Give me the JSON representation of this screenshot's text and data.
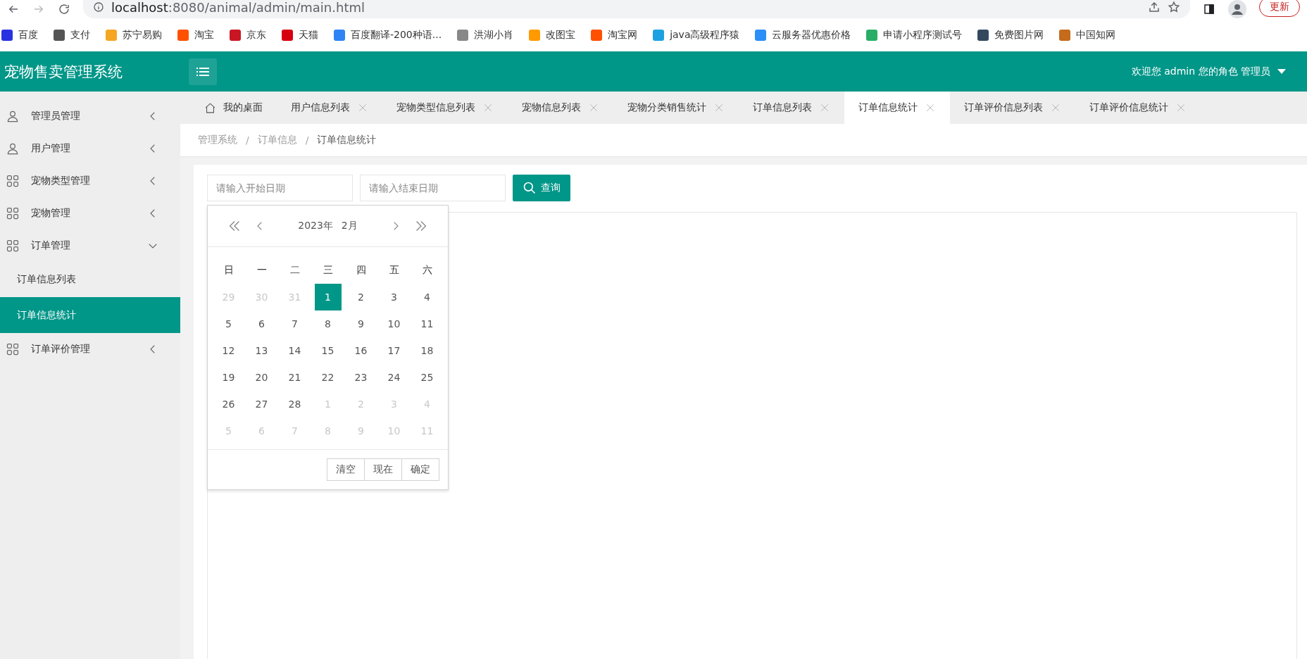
{
  "browser": {
    "url_host": "localhost",
    "url_rest": ":8080/animal/admin/main.html",
    "update_button": "更新",
    "bookmarks": [
      {
        "label": "百度",
        "color": "#2932e1"
      },
      {
        "label": "支付",
        "color": "#555555"
      },
      {
        "label": "苏宁易购",
        "color": "#f5a623"
      },
      {
        "label": "淘宝",
        "color": "#ff5000"
      },
      {
        "label": "京东",
        "color": "#c91623"
      },
      {
        "label": "天猫",
        "color": "#d6000f"
      },
      {
        "label": "百度翻译-200种语...",
        "color": "#2e84f4"
      },
      {
        "label": "洪湖小肖",
        "color": "#888888"
      },
      {
        "label": "改图宝",
        "color": "#ff9a00"
      },
      {
        "label": "淘宝网",
        "color": "#ff5000"
      },
      {
        "label": "java高级程序猿",
        "color": "#1ba1e2"
      },
      {
        "label": "云服务器优惠价格",
        "color": "#2c8ef8"
      },
      {
        "label": "申请小程序测试号",
        "color": "#2aae67"
      },
      {
        "label": "免费图片网",
        "color": "#34495e"
      },
      {
        "label": "中国知网",
        "color": "#c46b1c"
      }
    ]
  },
  "header": {
    "title": "宠物售卖管理系统",
    "user": "欢迎您 admin 您的角色 管理员"
  },
  "sidebar": {
    "items": [
      {
        "label": "管理员管理",
        "kind": "user",
        "expanded": false
      },
      {
        "label": "用户管理",
        "kind": "user",
        "expanded": false
      },
      {
        "label": "宠物类型管理",
        "kind": "grid",
        "expanded": false
      },
      {
        "label": "宠物管理",
        "kind": "grid",
        "expanded": false
      },
      {
        "label": "订单管理",
        "kind": "grid",
        "expanded": true,
        "children": [
          {
            "label": "订单信息列表",
            "selected": false
          },
          {
            "label": "订单信息统计",
            "selected": true
          }
        ]
      },
      {
        "label": "订单评价管理",
        "kind": "grid",
        "expanded": false
      }
    ]
  },
  "tabs": [
    {
      "label": "我的桌面",
      "kind": "home",
      "selected": false
    },
    {
      "label": "用户信息列表",
      "kind": "page",
      "selected": false
    },
    {
      "label": "宠物类型信息列表",
      "kind": "page",
      "selected": false
    },
    {
      "label": "宠物信息列表",
      "kind": "page",
      "selected": false
    },
    {
      "label": "宠物分类销售统计",
      "kind": "page",
      "selected": false
    },
    {
      "label": "订单信息列表",
      "kind": "page",
      "selected": false
    },
    {
      "label": "订单信息统计",
      "kind": "page",
      "selected": true
    },
    {
      "label": "订单评价信息列表",
      "kind": "page",
      "selected": false
    },
    {
      "label": "订单评价信息统计",
      "kind": "page",
      "selected": false
    }
  ],
  "breadcrumb": [
    {
      "kind": "link",
      "label": "管理系统"
    },
    {
      "kind": "separator",
      "label": "/"
    },
    {
      "kind": "link",
      "label": "订单信息"
    },
    {
      "kind": "separator",
      "label": "/"
    },
    {
      "kind": "current",
      "label": "订单信息统计"
    }
  ],
  "search": {
    "start_placeholder": "请输入开始日期",
    "end_placeholder": "请输入结束日期",
    "button": "查询"
  },
  "calendar": {
    "year": "2023年",
    "month": "2月",
    "weekdays": [
      "日",
      "一",
      "二",
      "三",
      "四",
      "五",
      "六"
    ],
    "weeks": [
      [
        {
          "label": "29",
          "outside": true,
          "selected": false
        },
        {
          "label": "30",
          "outside": true,
          "selected": false
        },
        {
          "label": "31",
          "outside": true,
          "selected": false
        },
        {
          "label": "1",
          "outside": false,
          "selected": true
        },
        {
          "label": "2",
          "outside": false,
          "selected": false
        },
        {
          "label": "3",
          "outside": false,
          "selected": false
        },
        {
          "label": "4",
          "outside": false,
          "selected": false
        }
      ],
      [
        {
          "label": "5",
          "outside": false,
          "selected": false
        },
        {
          "label": "6",
          "outside": false,
          "selected": false
        },
        {
          "label": "7",
          "outside": false,
          "selected": false
        },
        {
          "label": "8",
          "outside": false,
          "selected": false
        },
        {
          "label": "9",
          "outside": false,
          "selected": false
        },
        {
          "label": "10",
          "outside": false,
          "selected": false
        },
        {
          "label": "11",
          "outside": false,
          "selected": false
        }
      ],
      [
        {
          "label": "12",
          "outside": false,
          "selected": false
        },
        {
          "label": "13",
          "outside": false,
          "selected": false
        },
        {
          "label": "14",
          "outside": false,
          "selected": false
        },
        {
          "label": "15",
          "outside": false,
          "selected": false
        },
        {
          "label": "16",
          "outside": false,
          "selected": false
        },
        {
          "label": "17",
          "outside": false,
          "selected": false
        },
        {
          "label": "18",
          "outside": false,
          "selected": false
        }
      ],
      [
        {
          "label": "19",
          "outside": false,
          "selected": false
        },
        {
          "label": "20",
          "outside": false,
          "selected": false
        },
        {
          "label": "21",
          "outside": false,
          "selected": false
        },
        {
          "label": "22",
          "outside": false,
          "selected": false
        },
        {
          "label": "23",
          "outside": false,
          "selected": false
        },
        {
          "label": "24",
          "outside": false,
          "selected": false
        },
        {
          "label": "25",
          "outside": false,
          "selected": false
        }
      ],
      [
        {
          "label": "26",
          "outside": false,
          "selected": false
        },
        {
          "label": "27",
          "outside": false,
          "selected": false
        },
        {
          "label": "28",
          "outside": false,
          "selected": false
        },
        {
          "label": "1",
          "outside": true,
          "selected": false
        },
        {
          "label": "2",
          "outside": true,
          "selected": false
        },
        {
          "label": "3",
          "outside": true,
          "selected": false
        },
        {
          "label": "4",
          "outside": true,
          "selected": false
        }
      ],
      [
        {
          "label": "5",
          "outside": true,
          "selected": false
        },
        {
          "label": "6",
          "outside": true,
          "selected": false
        },
        {
          "label": "7",
          "outside": true,
          "selected": false
        },
        {
          "label": "8",
          "outside": true,
          "selected": false
        },
        {
          "label": "9",
          "outside": true,
          "selected": false
        },
        {
          "label": "10",
          "outside": true,
          "selected": false
        },
        {
          "label": "11",
          "outside": true,
          "selected": false
        }
      ]
    ],
    "buttons": [
      "清空",
      "现在",
      "确定"
    ]
  }
}
